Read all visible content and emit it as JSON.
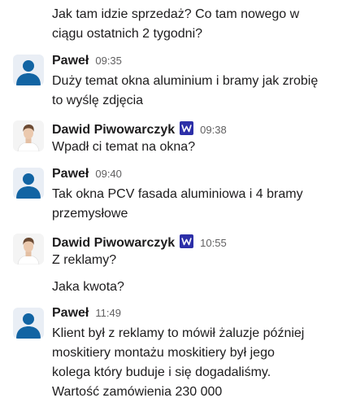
{
  "top_message": {
    "lines": [
      "Jak tam idzie sprzedaż? Co tam nowego w",
      "ciągu ostatnich 2 tygodni?"
    ]
  },
  "messages": [
    {
      "author": "Paweł",
      "time": "09:35",
      "avatar": "default-person-icon",
      "verified_badge": false,
      "lines": [
        "Duży temat okna aluminium i bramy jak zrobię",
        "to wyślę zdjęcia"
      ]
    },
    {
      "author": "Dawid Piwowarczyk",
      "time": "09:38",
      "avatar": "user-photo",
      "verified_badge": true,
      "lines": [
        "Wpadł ci temat na okna?"
      ]
    },
    {
      "author": "Paweł",
      "time": "09:40",
      "avatar": "default-person-icon",
      "verified_badge": false,
      "lines": [
        "Tak okna PCV fasada aluminiowa i 4 bramy",
        "przemysłowe"
      ]
    },
    {
      "author": "Dawid Piwowarczyk",
      "time": "10:55",
      "avatar": "user-photo",
      "verified_badge": true,
      "lines": [
        "Z reklamy?"
      ],
      "followup_lines": [
        "Jaka kwota?"
      ]
    },
    {
      "author": "Paweł",
      "time": "11:49",
      "avatar": "default-person-icon",
      "verified_badge": false,
      "lines": [
        "Klient był z reklamy to mówił żaluzje później",
        "moskitiery montażu moskitiery był jego",
        "kolega który buduje i się dogadaliśmy.",
        "Wartość zamówienia 230 000"
      ]
    }
  ],
  "colors": {
    "text": "#1d1c1d",
    "timestamp": "#616061",
    "default_avatar": "#1264a3",
    "badge": "#2c2fa8"
  }
}
